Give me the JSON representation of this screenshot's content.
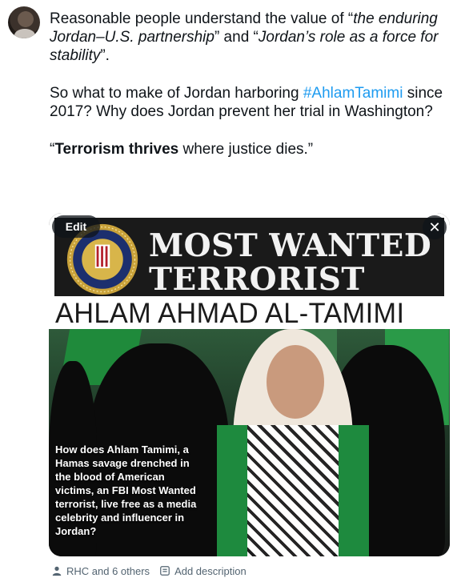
{
  "tweet": {
    "para1": {
      "t1": "Reasonable people understand the value of “",
      "e1": "the enduring Jordan–U.S. partnership",
      "t2": "” and “",
      "e2": "Jordan’s role as a force for stability",
      "t3": "”."
    },
    "para2": {
      "t1": "So what to make of Jordan harboring ",
      "hashtag": "#AhlamTamimi",
      "t2": " since 2017? Why does Jordan prevent her trial in Washington?"
    },
    "para3": {
      "t1": "“",
      "bold": "Terrorism thrives",
      "t2": " where justice dies.”"
    }
  },
  "media": {
    "edit_label": "Edit",
    "close_label": "✕",
    "headline_line1": "MOST WANTED",
    "headline_line2": "TERRORIST",
    "subject_name": "AHLAM AHMAD AL-TAMIMI",
    "caption": "How does Ahlam Tamimi, a Hamas savage drenched in the blood of American victims, an FBI Most Wanted terrorist, live free as a media celebrity and influencer in Jordan?",
    "seal_icon": "fbi-seal-icon"
  },
  "meta": {
    "people_icon": "person-icon",
    "tagged": "RHC and 6 others",
    "description_icon": "description-icon",
    "add_description": "Add description"
  },
  "colors": {
    "text": "#0f1419",
    "hashtag": "#1d9bf0",
    "meta": "#536471"
  }
}
